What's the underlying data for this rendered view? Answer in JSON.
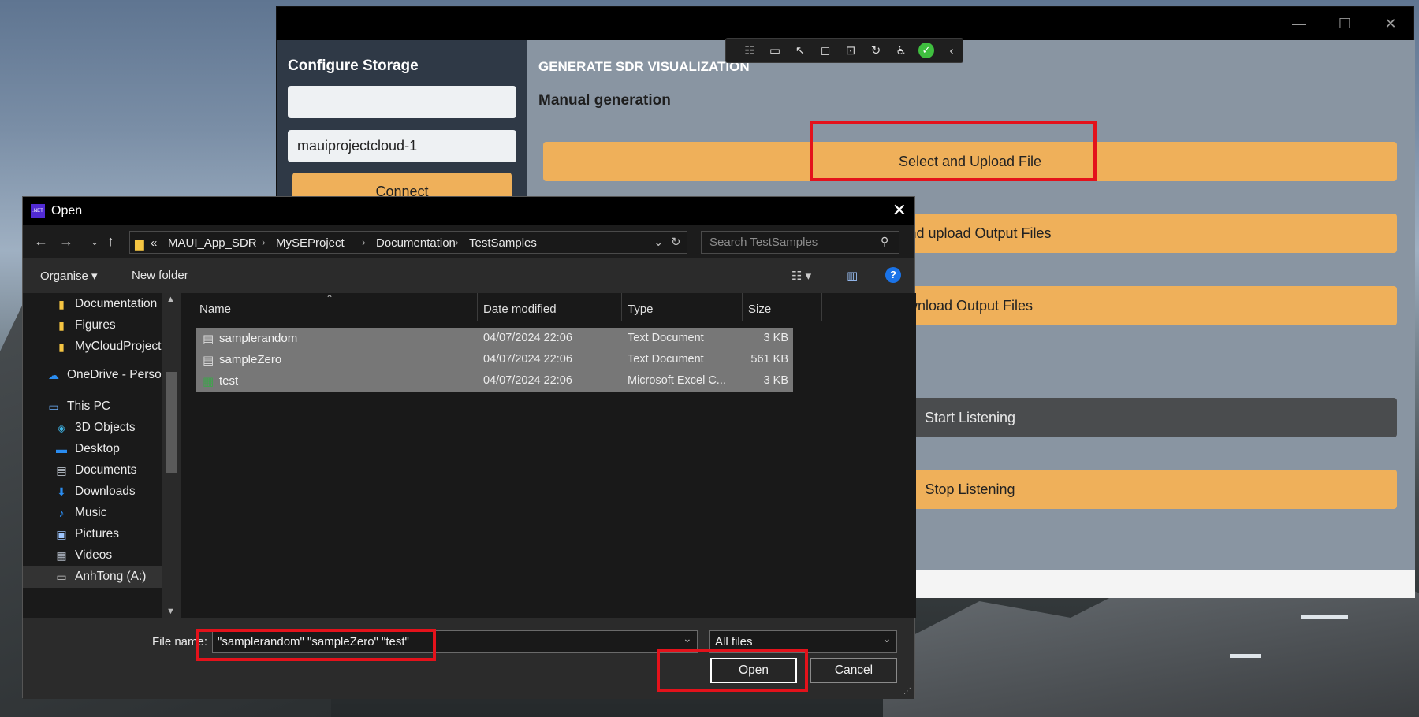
{
  "app": {
    "window_controls": {
      "minimize": "—",
      "maximize": "☐",
      "close": "✕"
    },
    "sidebar": {
      "heading": "Configure Storage",
      "input1_value": "",
      "input2_value": "mauiprojectcloud-1",
      "connect_label": "Connect"
    },
    "main": {
      "heading": "GENERATE SDR VISUALIZATION",
      "subheading": "Manual generation",
      "buttons": {
        "select_upload": "Select and Upload File",
        "generate_upload": "e and upload Output Files",
        "download": "wnload Output Files",
        "start_listening": "Start Listening",
        "stop_listening": "Stop Listening"
      }
    }
  },
  "dialog": {
    "title": "Open",
    "app_icon_text": ".NET",
    "breadcrumbs": [
      "«",
      "MAUI_App_SDR",
      "MySEProject",
      "Documentation",
      "TestSamples"
    ],
    "search_placeholder": "Search TestSamples",
    "commands": {
      "organise": "Organise ▾",
      "new_folder": "New folder"
    },
    "nav_items": [
      {
        "label": "Documentation",
        "icon": "folder-icon"
      },
      {
        "label": "Figures",
        "icon": "folder-icon"
      },
      {
        "label": "MyCloudProject",
        "icon": "folder-icon"
      },
      {
        "label": "OneDrive - Persor",
        "icon": "cloud-icon"
      },
      {
        "label": "This PC",
        "icon": "pc-icon"
      },
      {
        "label": "3D Objects",
        "icon": "cube-icon"
      },
      {
        "label": "Desktop",
        "icon": "desktop-icon"
      },
      {
        "label": "Documents",
        "icon": "document-icon"
      },
      {
        "label": "Downloads",
        "icon": "download-icon"
      },
      {
        "label": "Music",
        "icon": "music-icon"
      },
      {
        "label": "Pictures",
        "icon": "picture-icon"
      },
      {
        "label": "Videos",
        "icon": "video-icon"
      },
      {
        "label": "AnhTong (A:)",
        "icon": "drive-icon"
      }
    ],
    "columns": {
      "name": "Name",
      "date": "Date modified",
      "type": "Type",
      "size": "Size"
    },
    "files": [
      {
        "name": "samplerandom",
        "date": "04/07/2024 22:06",
        "type": "Text Document",
        "size": "3 KB"
      },
      {
        "name": "sampleZero",
        "date": "04/07/2024 22:06",
        "type": "Text Document",
        "size": "561 KB"
      },
      {
        "name": "test",
        "date": "04/07/2024 22:06",
        "type": "Microsoft Excel C...",
        "size": "3 KB"
      }
    ],
    "file_name_label": "File name:",
    "file_name_value": "\"samplerandom\" \"sampleZero\" \"test\"",
    "file_type_value": "All files",
    "open_label": "Open",
    "cancel_label": "Cancel"
  },
  "colors": {
    "accent_orange": "#efb05a",
    "highlight_red": "#e4121b",
    "sidebar_bg": "#2f3946",
    "main_bg": "#8995a2"
  }
}
